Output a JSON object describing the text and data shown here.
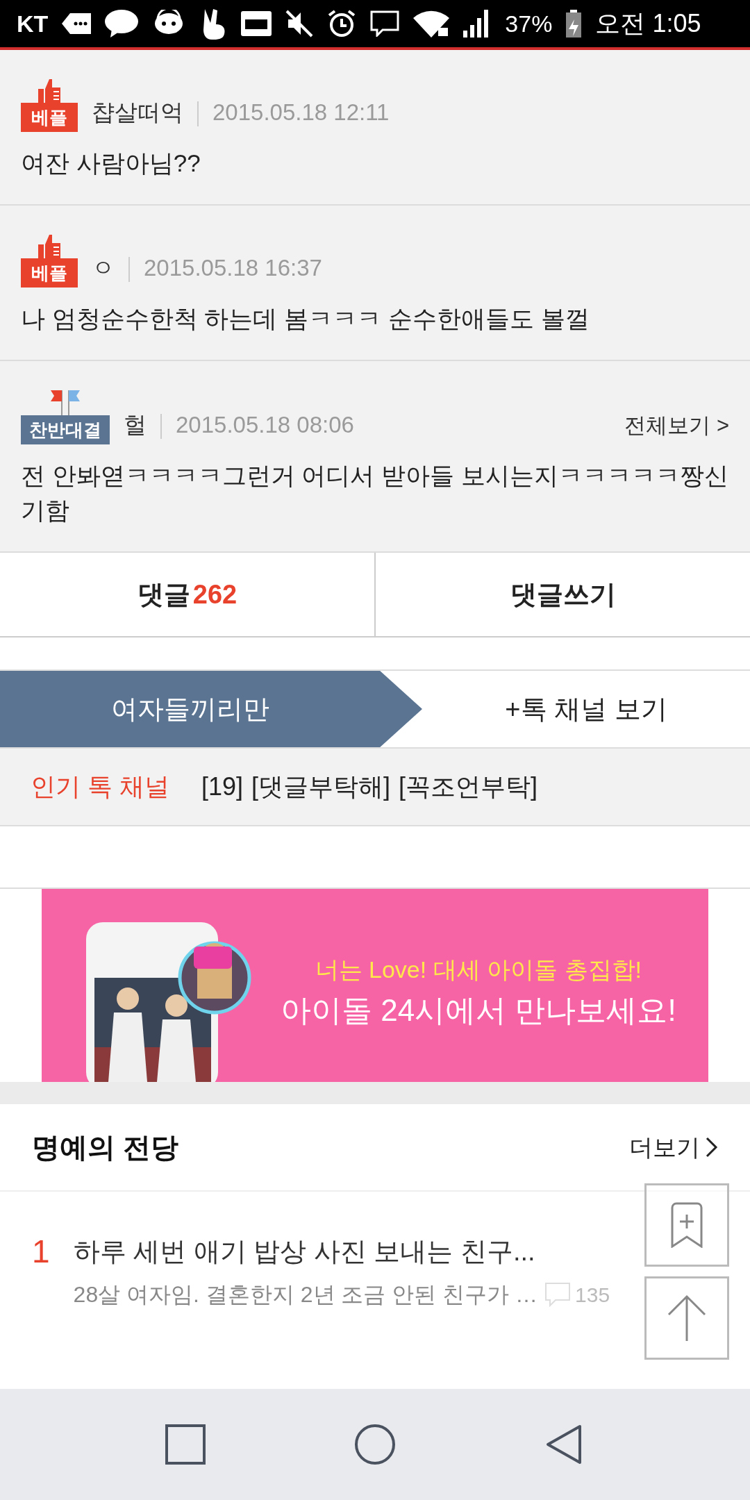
{
  "status_bar": {
    "carrier": "KT",
    "battery": "37%",
    "time": "오전 1:05"
  },
  "comments": [
    {
      "badge": {
        "kind": "best",
        "label": "베플"
      },
      "author": "챱살떠억",
      "date": "2015.05.18 12:11",
      "text": "여잔 사람아님??"
    },
    {
      "badge": {
        "kind": "best",
        "label": "베플"
      },
      "author": "ㅇ",
      "date": "2015.05.18 16:37",
      "text": "나 엄청순수한척 하는데 봄ㅋㅋㅋ 순수한애들도 볼껄"
    },
    {
      "badge": {
        "kind": "debate",
        "label": "찬반대결"
      },
      "author": "헐",
      "date": "2015.05.18 08:06",
      "text": "전 안봐엳ㅋㅋㅋㅋ그런거 어디서 받아들 보시는지ㅋㅋㅋㅋㅋ짱신기함",
      "view_all": "전체보기 >"
    }
  ],
  "comment_tabs": [
    {
      "label": "댓글",
      "count": "262"
    },
    {
      "label": "댓글쓰기"
    }
  ],
  "channel_tabs": [
    {
      "label": "여자들끼리만",
      "selected": true
    },
    {
      "label": "+톡 채널 보기",
      "selected": false
    }
  ],
  "popular": {
    "label": "인기 톡 채널",
    "items": [
      "[19]",
      "[댓글부탁해]",
      "[꼭조언부탁]"
    ]
  },
  "ad": {
    "tagline": "너는 Love! 대세 아이돌 총집합!",
    "headline": "아이돌 24시에서 만나보세요!"
  },
  "hall_of_fame": {
    "title": "명예의 전당",
    "more": "더보기",
    "items": [
      {
        "rank": "1",
        "title": "하루 세번 애기 밥상 사진 보내는 친구...",
        "preview": "28살 여자임. 결혼한지 2년 조금 안된 친구가 …",
        "comments": "135"
      }
    ]
  }
}
